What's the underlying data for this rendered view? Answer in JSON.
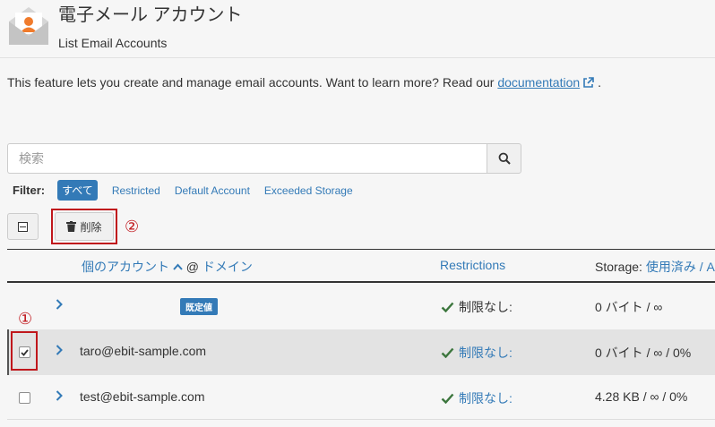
{
  "header": {
    "title": "電子メール アカウント",
    "subtitle": "List Email Accounts"
  },
  "intro": {
    "text": "This feature lets you create and manage email accounts. Want to learn more? Read our ",
    "link": "documentation",
    "tail": "."
  },
  "search": {
    "placeholder": "検索"
  },
  "filter": {
    "label": "Filter:",
    "options": [
      "すべて",
      "Restricted",
      "Default Account",
      "Exceeded Storage"
    ],
    "active": "すべて"
  },
  "toolbar": {
    "delete_label": "削除"
  },
  "annotations": {
    "one": "①",
    "two": "②"
  },
  "table": {
    "col_account": "個のアカウント",
    "col_at": "@",
    "col_domain": "ドメイン",
    "col_restrictions": "Restrictions",
    "col_storage_prefix": "Storage:",
    "col_storage_used": "使用済み",
    "col_storage_sep": " / A",
    "rows": [
      {
        "email": "",
        "badge": "既定値",
        "restriction": "制限なし:",
        "restriction_link": false,
        "storage": "0 バイト / ∞",
        "checked": null
      },
      {
        "email": "taro@ebit-sample.com",
        "badge": "",
        "restriction": "制限なし:",
        "restriction_link": true,
        "storage": "0 バイト / ∞ / 0%",
        "checked": true
      },
      {
        "email": "test@ebit-sample.com",
        "badge": "",
        "restriction": "制限なし:",
        "restriction_link": true,
        "storage": "4.28 KB / ∞ / 0%",
        "checked": false
      }
    ]
  },
  "colors": {
    "link": "#337ab7",
    "highlight": "#c0171c",
    "check": "#3c763d"
  }
}
